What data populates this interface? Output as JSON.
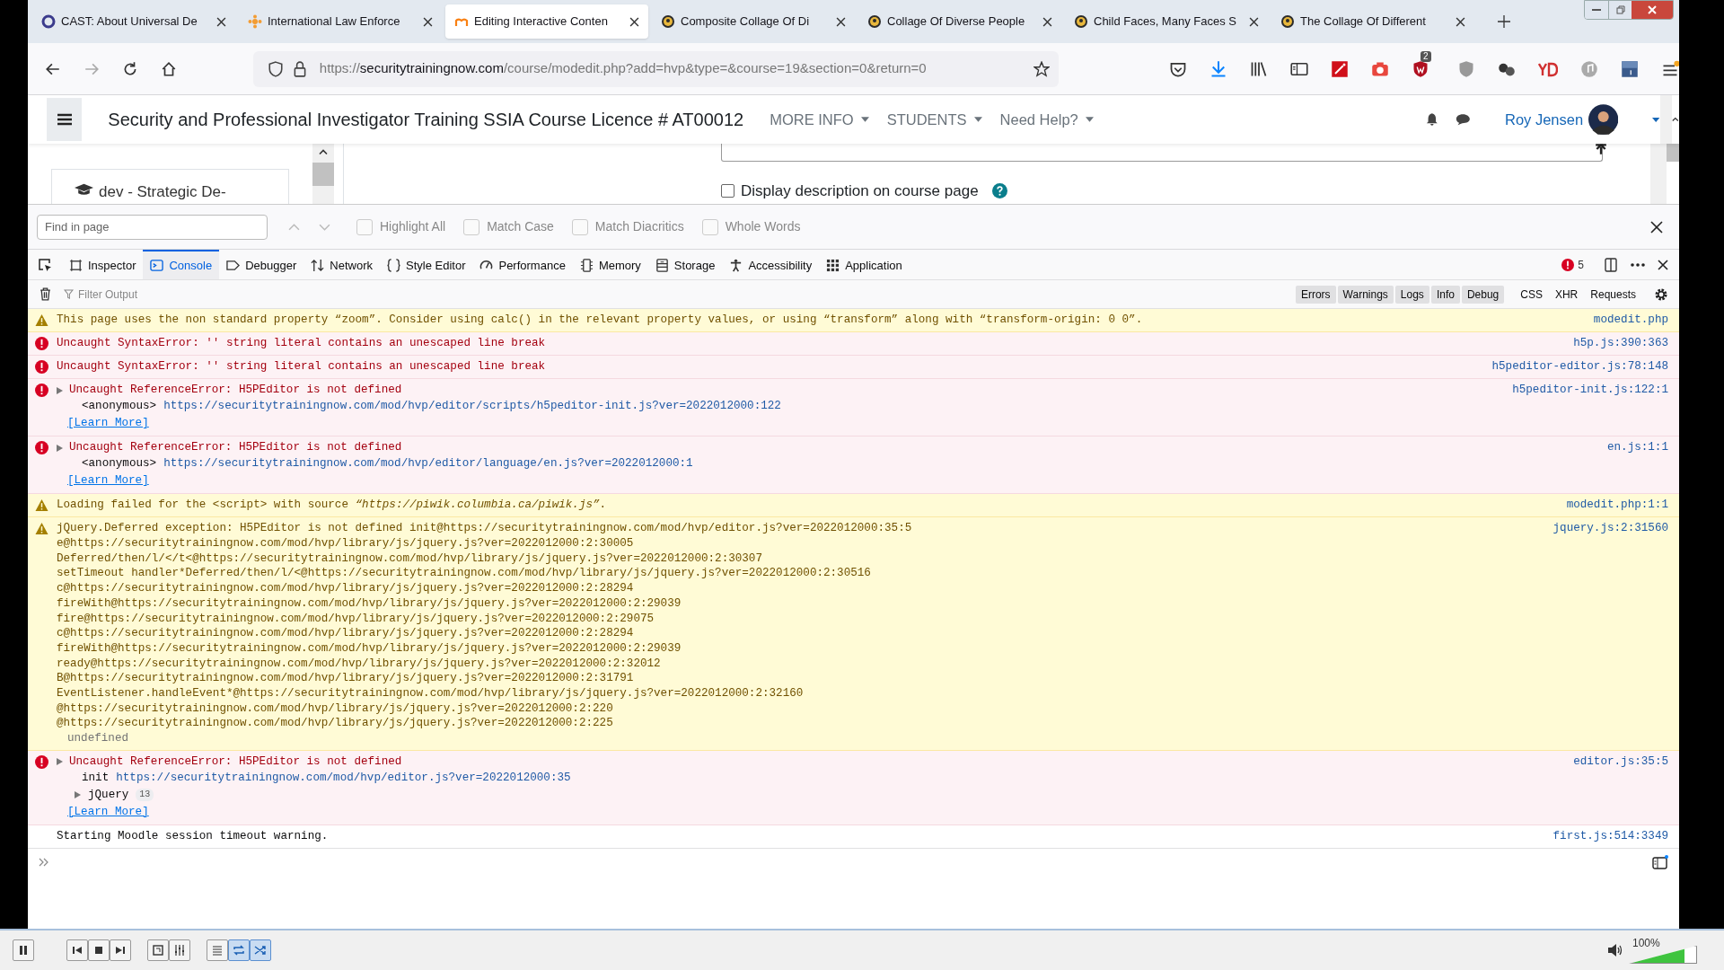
{
  "tabs": [
    {
      "title": "CAST: About Universal De",
      "selected": false
    },
    {
      "title": "International Law Enforce",
      "selected": false
    },
    {
      "title": "Editing Interactive Conten",
      "selected": true
    },
    {
      "title": "Composite Collage Of Di",
      "selected": false
    },
    {
      "title": "Collage Of Diverse People",
      "selected": false
    },
    {
      "title": "Child Faces, Many Faces S",
      "selected": false
    },
    {
      "title": "The Collage Of Different",
      "selected": false
    }
  ],
  "address_bar": {
    "scheme": "https://",
    "host": "securitytrainingnow.com",
    "path": "/course/modedit.php?add=hvp&type=&course=19&section=0&return=0"
  },
  "extension_badge": "2",
  "site_header": {
    "title": "Security and Professional Investigator Training SSIA Course Licence # AT00012",
    "menus": [
      "MORE INFO",
      "STUDENTS",
      "Need Help?"
    ],
    "user_name": "Roy Jensen"
  },
  "page": {
    "sidebar_item": "dev - Strategic De-",
    "display_description": {
      "label": "Display description on course page",
      "checked": false
    }
  },
  "find_bar": {
    "placeholder": "Find in page",
    "options": [
      {
        "label": "Highlight All",
        "checked": false
      },
      {
        "label": "Match Case",
        "checked": false
      },
      {
        "label": "Match Diacritics",
        "checked": false
      },
      {
        "label": "Whole Words",
        "checked": false
      }
    ]
  },
  "devtools": {
    "tabs": [
      {
        "label": "Inspector",
        "selected": false
      },
      {
        "label": "Console",
        "selected": true
      },
      {
        "label": "Debugger",
        "selected": false
      },
      {
        "label": "Network",
        "selected": false
      },
      {
        "label": "Style Editor",
        "selected": false
      },
      {
        "label": "Performance",
        "selected": false
      },
      {
        "label": "Memory",
        "selected": false
      },
      {
        "label": "Storage",
        "selected": false
      },
      {
        "label": "Accessibility",
        "selected": false
      },
      {
        "label": "Application",
        "selected": false
      }
    ],
    "error_count": "5",
    "filter_placeholder": "Filter Output",
    "filters": [
      {
        "label": "Errors",
        "on": true
      },
      {
        "label": "Warnings",
        "on": true
      },
      {
        "label": "Logs",
        "on": true
      },
      {
        "label": "Info",
        "on": true
      },
      {
        "label": "Debug",
        "on": true
      },
      {
        "label": "CSS",
        "on": false
      },
      {
        "label": "XHR",
        "on": false
      },
      {
        "label": "Requests",
        "on": false
      }
    ]
  },
  "console": {
    "messages": [
      {
        "kind": "warning",
        "text": "This page uses the non standard property “zoom”. Consider using calc() in the relevant property values, or using “transform” along with “transform-origin: 0 0”.",
        "source": "modedit.php"
      },
      {
        "kind": "error",
        "text": "Uncaught SyntaxError: '' string literal contains an unescaped line break",
        "source": "h5p.js:390:363"
      },
      {
        "kind": "error",
        "text": "Uncaught SyntaxError: '' string literal contains an unescaped line break",
        "source": "h5peditor-editor.js:78:148"
      },
      {
        "kind": "error",
        "expandable": true,
        "text": "Uncaught ReferenceError: H5PEditor is not defined",
        "trace": [
          {
            "fn": "<anonymous>",
            "url": "https://securitytrainingnow.com/mod/hvp/editor/scripts/h5peditor-init.js?ver=2022012000:122"
          }
        ],
        "learn_more": "[Learn More]",
        "source": "h5peditor-init.js:122:1"
      },
      {
        "kind": "error",
        "expandable": true,
        "text": "Uncaught ReferenceError: H5PEditor is not defined",
        "trace": [
          {
            "fn": "<anonymous>",
            "url": "https://securitytrainingnow.com/mod/hvp/editor/language/en.js?ver=2022012000:1"
          }
        ],
        "learn_more": "[Learn More]",
        "source": "en.js:1:1"
      },
      {
        "kind": "warning",
        "text": "Loading failed for the <script> with source *“https://piwik.columbia.ca/piwik.js”*.",
        "source": "modedit.php:1:1"
      },
      {
        "kind": "warning",
        "text": "jQuery.Deferred exception: H5PEditor is not defined init@https://securitytrainingnow.com/mod/hvp/editor.js?ver=2022012000:35:5",
        "lines": [
          "e@https://securitytrainingnow.com/mod/hvp/library/js/jquery.js?ver=2022012000:2:30005",
          "Deferred/then/l/</t<@https://securitytrainingnow.com/mod/hvp/library/js/jquery.js?ver=2022012000:2:30307",
          "setTimeout handler*Deferred/then/l/<@https://securitytrainingnow.com/mod/hvp/library/js/jquery.js?ver=2022012000:2:30516",
          "c@https://securitytrainingnow.com/mod/hvp/library/js/jquery.js?ver=2022012000:2:28294",
          "fireWith@https://securitytrainingnow.com/mod/hvp/library/js/jquery.js?ver=2022012000:2:29039",
          "fire@https://securitytrainingnow.com/mod/hvp/library/js/jquery.js?ver=2022012000:2:29075",
          "c@https://securitytrainingnow.com/mod/hvp/library/js/jquery.js?ver=2022012000:2:28294",
          "fireWith@https://securitytrainingnow.com/mod/hvp/library/js/jquery.js?ver=2022012000:2:29039",
          "ready@https://securitytrainingnow.com/mod/hvp/library/js/jquery.js?ver=2022012000:2:32012",
          "B@https://securitytrainingnow.com/mod/hvp/library/js/jquery.js?ver=2022012000:2:31791",
          "EventListener.handleEvent*@https://securitytrainingnow.com/mod/hvp/library/js/jquery.js?ver=2022012000:2:32160",
          "@https://securitytrainingnow.com/mod/hvp/library/js/jquery.js?ver=2022012000:2:220",
          "@https://securitytrainingnow.com/mod/hvp/library/js/jquery.js?ver=2022012000:2:225"
        ],
        "result": "undefined",
        "source": "jquery.js:2:31560"
      },
      {
        "kind": "error",
        "expandable": true,
        "text": "Uncaught ReferenceError: H5PEditor is not defined",
        "trace": [
          {
            "fn": "init",
            "url": "https://securitytrainingnow.com/mod/hvp/editor.js?ver=2022012000:35"
          },
          {
            "fn": "jQuery",
            "count": "13",
            "expandable": true
          }
        ],
        "learn_more": "[Learn More]",
        "source": "editor.js:35:5"
      },
      {
        "kind": "log",
        "text": "Starting Moodle session timeout warning.",
        "source": "first.js:514:3349"
      }
    ]
  },
  "media_player": {
    "zoom": "100%",
    "volume": {
      "level": 0.82
    }
  }
}
